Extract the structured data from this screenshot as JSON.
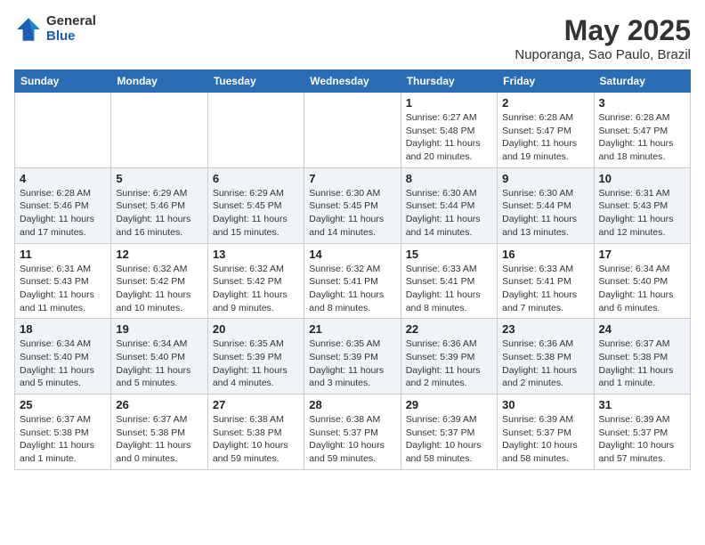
{
  "header": {
    "logo_general": "General",
    "logo_blue": "Blue",
    "title": "May 2025",
    "location": "Nuporanga, Sao Paulo, Brazil"
  },
  "days_of_week": [
    "Sunday",
    "Monday",
    "Tuesday",
    "Wednesday",
    "Thursday",
    "Friday",
    "Saturday"
  ],
  "weeks": [
    [
      {
        "day": "",
        "info": ""
      },
      {
        "day": "",
        "info": ""
      },
      {
        "day": "",
        "info": ""
      },
      {
        "day": "",
        "info": ""
      },
      {
        "day": "1",
        "info": "Sunrise: 6:27 AM\nSunset: 5:48 PM\nDaylight: 11 hours and 20 minutes."
      },
      {
        "day": "2",
        "info": "Sunrise: 6:28 AM\nSunset: 5:47 PM\nDaylight: 11 hours and 19 minutes."
      },
      {
        "day": "3",
        "info": "Sunrise: 6:28 AM\nSunset: 5:47 PM\nDaylight: 11 hours and 18 minutes."
      }
    ],
    [
      {
        "day": "4",
        "info": "Sunrise: 6:28 AM\nSunset: 5:46 PM\nDaylight: 11 hours and 17 minutes."
      },
      {
        "day": "5",
        "info": "Sunrise: 6:29 AM\nSunset: 5:46 PM\nDaylight: 11 hours and 16 minutes."
      },
      {
        "day": "6",
        "info": "Sunrise: 6:29 AM\nSunset: 5:45 PM\nDaylight: 11 hours and 15 minutes."
      },
      {
        "day": "7",
        "info": "Sunrise: 6:30 AM\nSunset: 5:45 PM\nDaylight: 11 hours and 14 minutes."
      },
      {
        "day": "8",
        "info": "Sunrise: 6:30 AM\nSunset: 5:44 PM\nDaylight: 11 hours and 14 minutes."
      },
      {
        "day": "9",
        "info": "Sunrise: 6:30 AM\nSunset: 5:44 PM\nDaylight: 11 hours and 13 minutes."
      },
      {
        "day": "10",
        "info": "Sunrise: 6:31 AM\nSunset: 5:43 PM\nDaylight: 11 hours and 12 minutes."
      }
    ],
    [
      {
        "day": "11",
        "info": "Sunrise: 6:31 AM\nSunset: 5:43 PM\nDaylight: 11 hours and 11 minutes."
      },
      {
        "day": "12",
        "info": "Sunrise: 6:32 AM\nSunset: 5:42 PM\nDaylight: 11 hours and 10 minutes."
      },
      {
        "day": "13",
        "info": "Sunrise: 6:32 AM\nSunset: 5:42 PM\nDaylight: 11 hours and 9 minutes."
      },
      {
        "day": "14",
        "info": "Sunrise: 6:32 AM\nSunset: 5:41 PM\nDaylight: 11 hours and 8 minutes."
      },
      {
        "day": "15",
        "info": "Sunrise: 6:33 AM\nSunset: 5:41 PM\nDaylight: 11 hours and 8 minutes."
      },
      {
        "day": "16",
        "info": "Sunrise: 6:33 AM\nSunset: 5:41 PM\nDaylight: 11 hours and 7 minutes."
      },
      {
        "day": "17",
        "info": "Sunrise: 6:34 AM\nSunset: 5:40 PM\nDaylight: 11 hours and 6 minutes."
      }
    ],
    [
      {
        "day": "18",
        "info": "Sunrise: 6:34 AM\nSunset: 5:40 PM\nDaylight: 11 hours and 5 minutes."
      },
      {
        "day": "19",
        "info": "Sunrise: 6:34 AM\nSunset: 5:40 PM\nDaylight: 11 hours and 5 minutes."
      },
      {
        "day": "20",
        "info": "Sunrise: 6:35 AM\nSunset: 5:39 PM\nDaylight: 11 hours and 4 minutes."
      },
      {
        "day": "21",
        "info": "Sunrise: 6:35 AM\nSunset: 5:39 PM\nDaylight: 11 hours and 3 minutes."
      },
      {
        "day": "22",
        "info": "Sunrise: 6:36 AM\nSunset: 5:39 PM\nDaylight: 11 hours and 2 minutes."
      },
      {
        "day": "23",
        "info": "Sunrise: 6:36 AM\nSunset: 5:38 PM\nDaylight: 11 hours and 2 minutes."
      },
      {
        "day": "24",
        "info": "Sunrise: 6:37 AM\nSunset: 5:38 PM\nDaylight: 11 hours and 1 minute."
      }
    ],
    [
      {
        "day": "25",
        "info": "Sunrise: 6:37 AM\nSunset: 5:38 PM\nDaylight: 11 hours and 1 minute."
      },
      {
        "day": "26",
        "info": "Sunrise: 6:37 AM\nSunset: 5:38 PM\nDaylight: 11 hours and 0 minutes."
      },
      {
        "day": "27",
        "info": "Sunrise: 6:38 AM\nSunset: 5:38 PM\nDaylight: 10 hours and 59 minutes."
      },
      {
        "day": "28",
        "info": "Sunrise: 6:38 AM\nSunset: 5:37 PM\nDaylight: 10 hours and 59 minutes."
      },
      {
        "day": "29",
        "info": "Sunrise: 6:39 AM\nSunset: 5:37 PM\nDaylight: 10 hours and 58 minutes."
      },
      {
        "day": "30",
        "info": "Sunrise: 6:39 AM\nSunset: 5:37 PM\nDaylight: 10 hours and 58 minutes."
      },
      {
        "day": "31",
        "info": "Sunrise: 6:39 AM\nSunset: 5:37 PM\nDaylight: 10 hours and 57 minutes."
      }
    ]
  ]
}
